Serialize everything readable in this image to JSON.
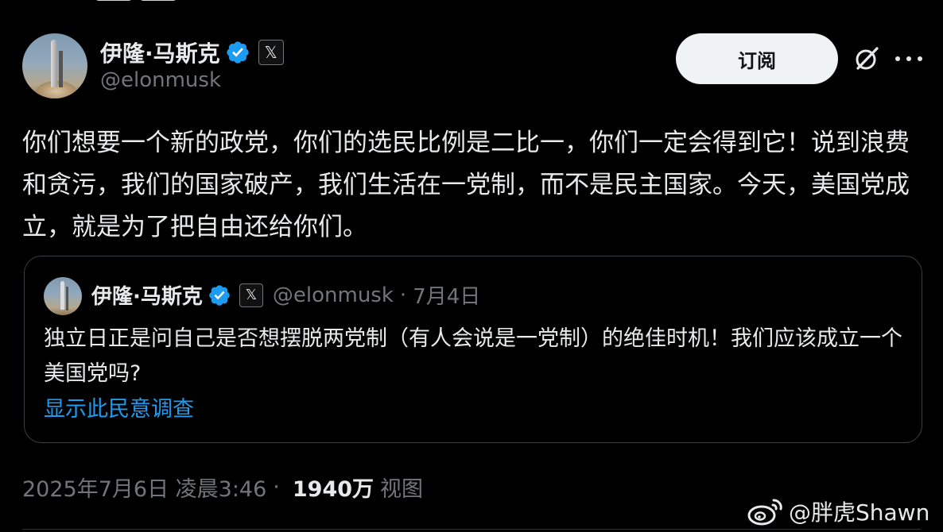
{
  "author": {
    "name": "伊隆·马斯克",
    "handle": "@elonmusk",
    "x_badge": "𝕏"
  },
  "actions": {
    "subscribe_label": "订阅"
  },
  "post": {
    "text": "你们想要一个新的政党，你们的选民比例是二比一，你们一定会得到它！说到浪费和贪污，我们的国家破产，我们生活在一党制，而不是民主国家。今天，美国党成立，就是为了把自由还给你们。"
  },
  "quoted": {
    "name": "伊隆·马斯克",
    "x_badge": "𝕏",
    "handle": "@elonmusk",
    "separator": "·",
    "date": "7月4日",
    "text": "独立日正是问自己是否想摆脱两党制（有人会说是一党制）的绝佳时机！我们应该成立一个美国党吗?",
    "poll_link": "显示此民意调查"
  },
  "meta": {
    "timestamp": "2025年7月6日 凌晨3:46",
    "separator": "·",
    "views_count": "1940万",
    "views_label": "视图"
  },
  "watermark": {
    "text": "@胖虎Shawn"
  },
  "colors": {
    "background": "#000000",
    "text": "#e7e9ea",
    "muted": "#71767b",
    "link": "#1d9bf0",
    "verified": "#1d9bf0"
  }
}
